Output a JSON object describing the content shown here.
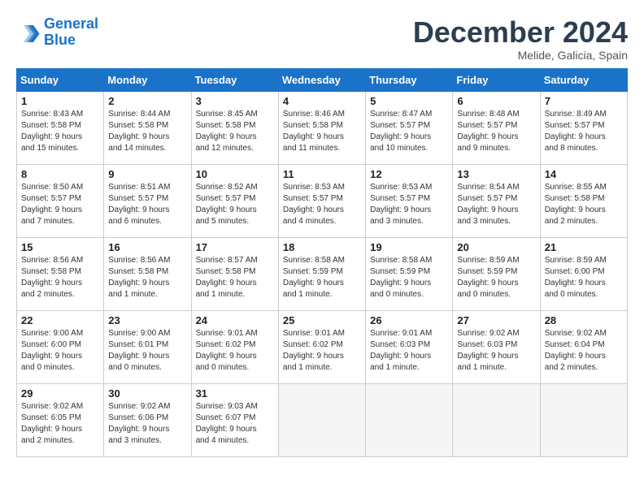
{
  "header": {
    "logo_line1": "General",
    "logo_line2": "Blue",
    "month": "December 2024",
    "location": "Melide, Galicia, Spain"
  },
  "days_of_week": [
    "Sunday",
    "Monday",
    "Tuesday",
    "Wednesday",
    "Thursday",
    "Friday",
    "Saturday"
  ],
  "weeks": [
    [
      {
        "day": "1",
        "lines": [
          "Sunrise: 8:43 AM",
          "Sunset: 5:58 PM",
          "Daylight: 9 hours",
          "and 15 minutes."
        ]
      },
      {
        "day": "2",
        "lines": [
          "Sunrise: 8:44 AM",
          "Sunset: 5:58 PM",
          "Daylight: 9 hours",
          "and 14 minutes."
        ]
      },
      {
        "day": "3",
        "lines": [
          "Sunrise: 8:45 AM",
          "Sunset: 5:58 PM",
          "Daylight: 9 hours",
          "and 12 minutes."
        ]
      },
      {
        "day": "4",
        "lines": [
          "Sunrise: 8:46 AM",
          "Sunset: 5:58 PM",
          "Daylight: 9 hours",
          "and 11 minutes."
        ]
      },
      {
        "day": "5",
        "lines": [
          "Sunrise: 8:47 AM",
          "Sunset: 5:57 PM",
          "Daylight: 9 hours",
          "and 10 minutes."
        ]
      },
      {
        "day": "6",
        "lines": [
          "Sunrise: 8:48 AM",
          "Sunset: 5:57 PM",
          "Daylight: 9 hours",
          "and 9 minutes."
        ]
      },
      {
        "day": "7",
        "lines": [
          "Sunrise: 8:49 AM",
          "Sunset: 5:57 PM",
          "Daylight: 9 hours",
          "and 8 minutes."
        ]
      }
    ],
    [
      {
        "day": "8",
        "lines": [
          "Sunrise: 8:50 AM",
          "Sunset: 5:57 PM",
          "Daylight: 9 hours",
          "and 7 minutes."
        ]
      },
      {
        "day": "9",
        "lines": [
          "Sunrise: 8:51 AM",
          "Sunset: 5:57 PM",
          "Daylight: 9 hours",
          "and 6 minutes."
        ]
      },
      {
        "day": "10",
        "lines": [
          "Sunrise: 8:52 AM",
          "Sunset: 5:57 PM",
          "Daylight: 9 hours",
          "and 5 minutes."
        ]
      },
      {
        "day": "11",
        "lines": [
          "Sunrise: 8:53 AM",
          "Sunset: 5:57 PM",
          "Daylight: 9 hours",
          "and 4 minutes."
        ]
      },
      {
        "day": "12",
        "lines": [
          "Sunrise: 8:53 AM",
          "Sunset: 5:57 PM",
          "Daylight: 9 hours",
          "and 3 minutes."
        ]
      },
      {
        "day": "13",
        "lines": [
          "Sunrise: 8:54 AM",
          "Sunset: 5:57 PM",
          "Daylight: 9 hours",
          "and 3 minutes."
        ]
      },
      {
        "day": "14",
        "lines": [
          "Sunrise: 8:55 AM",
          "Sunset: 5:58 PM",
          "Daylight: 9 hours",
          "and 2 minutes."
        ]
      }
    ],
    [
      {
        "day": "15",
        "lines": [
          "Sunrise: 8:56 AM",
          "Sunset: 5:58 PM",
          "Daylight: 9 hours",
          "and 2 minutes."
        ]
      },
      {
        "day": "16",
        "lines": [
          "Sunrise: 8:56 AM",
          "Sunset: 5:58 PM",
          "Daylight: 9 hours",
          "and 1 minute."
        ]
      },
      {
        "day": "17",
        "lines": [
          "Sunrise: 8:57 AM",
          "Sunset: 5:58 PM",
          "Daylight: 9 hours",
          "and 1 minute."
        ]
      },
      {
        "day": "18",
        "lines": [
          "Sunrise: 8:58 AM",
          "Sunset: 5:59 PM",
          "Daylight: 9 hours",
          "and 1 minute."
        ]
      },
      {
        "day": "19",
        "lines": [
          "Sunrise: 8:58 AM",
          "Sunset: 5:59 PM",
          "Daylight: 9 hours",
          "and 0 minutes."
        ]
      },
      {
        "day": "20",
        "lines": [
          "Sunrise: 8:59 AM",
          "Sunset: 5:59 PM",
          "Daylight: 9 hours",
          "and 0 minutes."
        ]
      },
      {
        "day": "21",
        "lines": [
          "Sunrise: 8:59 AM",
          "Sunset: 6:00 PM",
          "Daylight: 9 hours",
          "and 0 minutes."
        ]
      }
    ],
    [
      {
        "day": "22",
        "lines": [
          "Sunrise: 9:00 AM",
          "Sunset: 6:00 PM",
          "Daylight: 9 hours",
          "and 0 minutes."
        ]
      },
      {
        "day": "23",
        "lines": [
          "Sunrise: 9:00 AM",
          "Sunset: 6:01 PM",
          "Daylight: 9 hours",
          "and 0 minutes."
        ]
      },
      {
        "day": "24",
        "lines": [
          "Sunrise: 9:01 AM",
          "Sunset: 6:02 PM",
          "Daylight: 9 hours",
          "and 0 minutes."
        ]
      },
      {
        "day": "25",
        "lines": [
          "Sunrise: 9:01 AM",
          "Sunset: 6:02 PM",
          "Daylight: 9 hours",
          "and 1 minute."
        ]
      },
      {
        "day": "26",
        "lines": [
          "Sunrise: 9:01 AM",
          "Sunset: 6:03 PM",
          "Daylight: 9 hours",
          "and 1 minute."
        ]
      },
      {
        "day": "27",
        "lines": [
          "Sunrise: 9:02 AM",
          "Sunset: 6:03 PM",
          "Daylight: 9 hours",
          "and 1 minute."
        ]
      },
      {
        "day": "28",
        "lines": [
          "Sunrise: 9:02 AM",
          "Sunset: 6:04 PM",
          "Daylight: 9 hours",
          "and 2 minutes."
        ]
      }
    ],
    [
      {
        "day": "29",
        "lines": [
          "Sunrise: 9:02 AM",
          "Sunset: 6:05 PM",
          "Daylight: 9 hours",
          "and 2 minutes."
        ]
      },
      {
        "day": "30",
        "lines": [
          "Sunrise: 9:02 AM",
          "Sunset: 6:06 PM",
          "Daylight: 9 hours",
          "and 3 minutes."
        ]
      },
      {
        "day": "31",
        "lines": [
          "Sunrise: 9:03 AM",
          "Sunset: 6:07 PM",
          "Daylight: 9 hours",
          "and 4 minutes."
        ]
      },
      null,
      null,
      null,
      null
    ]
  ]
}
